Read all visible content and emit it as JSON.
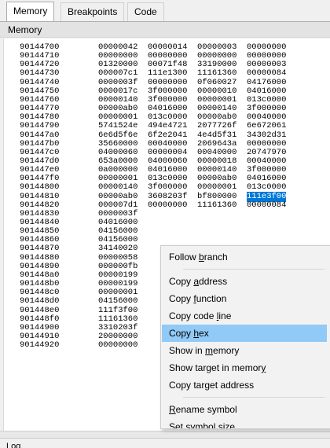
{
  "tabs": [
    {
      "label": "Memory"
    },
    {
      "label": "Breakpoints"
    },
    {
      "label": "Code"
    }
  ],
  "panel_title": "Memory",
  "bottom_label": "Log",
  "rows": [
    {
      "addr": "90144700",
      "w": [
        "00000042",
        "00000014",
        "00000003",
        "00000000"
      ]
    },
    {
      "addr": "90144710",
      "w": [
        "00000000",
        "00000000",
        "00000000",
        "00000000"
      ]
    },
    {
      "addr": "90144720",
      "w": [
        "01320000",
        "00071f48",
        "33190000",
        "00000003"
      ]
    },
    {
      "addr": "90144730",
      "w": [
        "000007c1",
        "111e1300",
        "11161360",
        "00000084"
      ]
    },
    {
      "addr": "90144740",
      "w": [
        "0000003f",
        "00000000",
        "0f060027",
        "04176000"
      ]
    },
    {
      "addr": "90144750",
      "w": [
        "0000017c",
        "3f000000",
        "00000010",
        "04016000"
      ]
    },
    {
      "addr": "90144760",
      "w": [
        "00000140",
        "3f000000",
        "00000001",
        "013c0000"
      ]
    },
    {
      "addr": "90144770",
      "w": [
        "00000ab0",
        "04016000",
        "00000140",
        "3f000000"
      ]
    },
    {
      "addr": "90144780",
      "w": [
        "00000001",
        "013c0000",
        "00000ab0",
        "00040000"
      ]
    },
    {
      "addr": "90144790",
      "w": [
        "5741524e",
        "494e4721",
        "2077726f",
        "6e672061"
      ]
    },
    {
      "addr": "901447a0",
      "w": [
        "6e6d5f6e",
        "6f2e2041",
        "4e4d5f31",
        "34302d31"
      ]
    },
    {
      "addr": "901447b0",
      "w": [
        "35660000",
        "00040000",
        "2069643a",
        "00000000"
      ]
    },
    {
      "addr": "901447c0",
      "w": [
        "04000060",
        "00000004",
        "00040000",
        "20747970"
      ]
    },
    {
      "addr": "901447d0",
      "w": [
        "653a0000",
        "04000060",
        "00000018",
        "00040000"
      ]
    },
    {
      "addr": "901447e0",
      "w": [
        "0a000000",
        "04016000",
        "00000140",
        "3f000000"
      ]
    },
    {
      "addr": "901447f0",
      "w": [
        "00000001",
        "013c0000",
        "00000ab0",
        "04016000"
      ]
    },
    {
      "addr": "90144800",
      "w": [
        "00000140",
        "3f000000",
        "00000001",
        "013c0000"
      ]
    },
    {
      "addr": "90144810",
      "w": [
        "00000ab0",
        "3608203f",
        "bf800000",
        "111e3f00"
      ]
    },
    {
      "addr": "90144820",
      "w": [
        "000007d1",
        "00000000",
        "11161360",
        "00000084"
      ]
    },
    {
      "addr": "90144830",
      "w": [
        "0000003f",
        "",
        "",
        ""
      ]
    },
    {
      "addr": "90144840",
      "w": [
        "04016000",
        "",
        "",
        ""
      ]
    },
    {
      "addr": "90144850",
      "w": [
        "04156000",
        "",
        "",
        ""
      ]
    },
    {
      "addr": "90144860",
      "w": [
        "04156000",
        "",
        "",
        ""
      ]
    },
    {
      "addr": "90144870",
      "w": [
        "34140020",
        "",
        "",
        ""
      ]
    },
    {
      "addr": "90144880",
      "w": [
        "00000058",
        "",
        "",
        ""
      ]
    },
    {
      "addr": "90144890",
      "w": [
        "000000fb",
        "",
        "",
        ""
      ]
    },
    {
      "addr": "901448a0",
      "w": [
        "00000199",
        "",
        "",
        ""
      ]
    },
    {
      "addr": "901448b0",
      "w": [
        "00000199",
        "",
        "",
        ""
      ]
    },
    {
      "addr": "901448c0",
      "w": [
        "00000001",
        "",
        "",
        ""
      ]
    },
    {
      "addr": "901448d0",
      "w": [
        "04156000",
        "",
        "",
        ""
      ]
    },
    {
      "addr": "901448e0",
      "w": [
        "111f3f00",
        "",
        "",
        ""
      ]
    },
    {
      "addr": "901448f0",
      "w": [
        "11161360",
        "",
        "",
        ""
      ]
    },
    {
      "addr": "90144900",
      "w": [
        "3310203f",
        "",
        "",
        ""
      ]
    },
    {
      "addr": "90144910",
      "w": [
        "20000000",
        "",
        "",
        ""
      ]
    },
    {
      "addr": "90144920",
      "w": [
        "00000000",
        "",
        "",
        ""
      ]
    }
  ],
  "selected": {
    "row": 17,
    "col": 3
  },
  "menu": [
    {
      "label": "Follow branch",
      "underline": "b"
    },
    {
      "sep": true
    },
    {
      "label": "Copy address",
      "underline": "a"
    },
    {
      "label": "Copy function",
      "underline": "f"
    },
    {
      "label": "Copy code line",
      "underline": "l"
    },
    {
      "label": "Copy hex",
      "underline": "h",
      "highlighted": true
    },
    {
      "label": "Show in memory",
      "underline": "m"
    },
    {
      "label": "Show target in memory",
      "underline": "y"
    },
    {
      "label": "Copy target address",
      "underline": "g"
    },
    {
      "sep": true
    },
    {
      "label": "Rename symbol",
      "underline": "R"
    },
    {
      "label": "Set symbol size",
      "underline": ""
    }
  ],
  "colors": {
    "selection": "#0078d7",
    "menu_highlight": "#91c9f7"
  }
}
